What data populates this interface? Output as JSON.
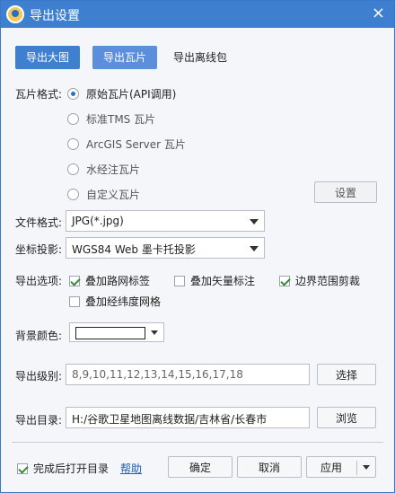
{
  "window": {
    "title": "导出设置",
    "close": "×"
  },
  "tabs": [
    "导出大图",
    "导出瓦片",
    "导出离线包"
  ],
  "tile_format": {
    "label": "瓦片格式:",
    "options": [
      "原始瓦片(API调用)",
      "标准TMS 瓦片",
      "ArcGIS Server 瓦片",
      "水经注瓦片",
      "自定义瓦片"
    ],
    "selected_index": 0,
    "settings_button": "设置"
  },
  "file_format": {
    "label": "文件格式:",
    "value": "JPG(*.jpg)"
  },
  "projection": {
    "label": "坐标投影:",
    "value": "WGS84 Web 墨卡托投影"
  },
  "export_options": {
    "label": "导出选项:",
    "items": [
      {
        "label": "叠加路网标签",
        "checked": true
      },
      {
        "label": "叠加矢量标注",
        "checked": false
      },
      {
        "label": "边界范围剪裁",
        "checked": true
      },
      {
        "label": "叠加经纬度网格",
        "checked": false
      }
    ]
  },
  "background_color": {
    "label": "背景颜色:",
    "value": "#ffffff"
  },
  "export_levels": {
    "label": "导出级别:",
    "value": "8,9,10,11,12,13,14,15,16,17,18",
    "button": "选择"
  },
  "export_dir": {
    "label": "导出目录:",
    "value": "H:/谷歌卫星地图离线数据/吉林省/长春市",
    "button": "浏览"
  },
  "footer": {
    "open_after": {
      "label": "完成后打开目录",
      "checked": true
    },
    "help": "帮助",
    "ok": "确定",
    "cancel": "取消",
    "apply": "应用"
  }
}
